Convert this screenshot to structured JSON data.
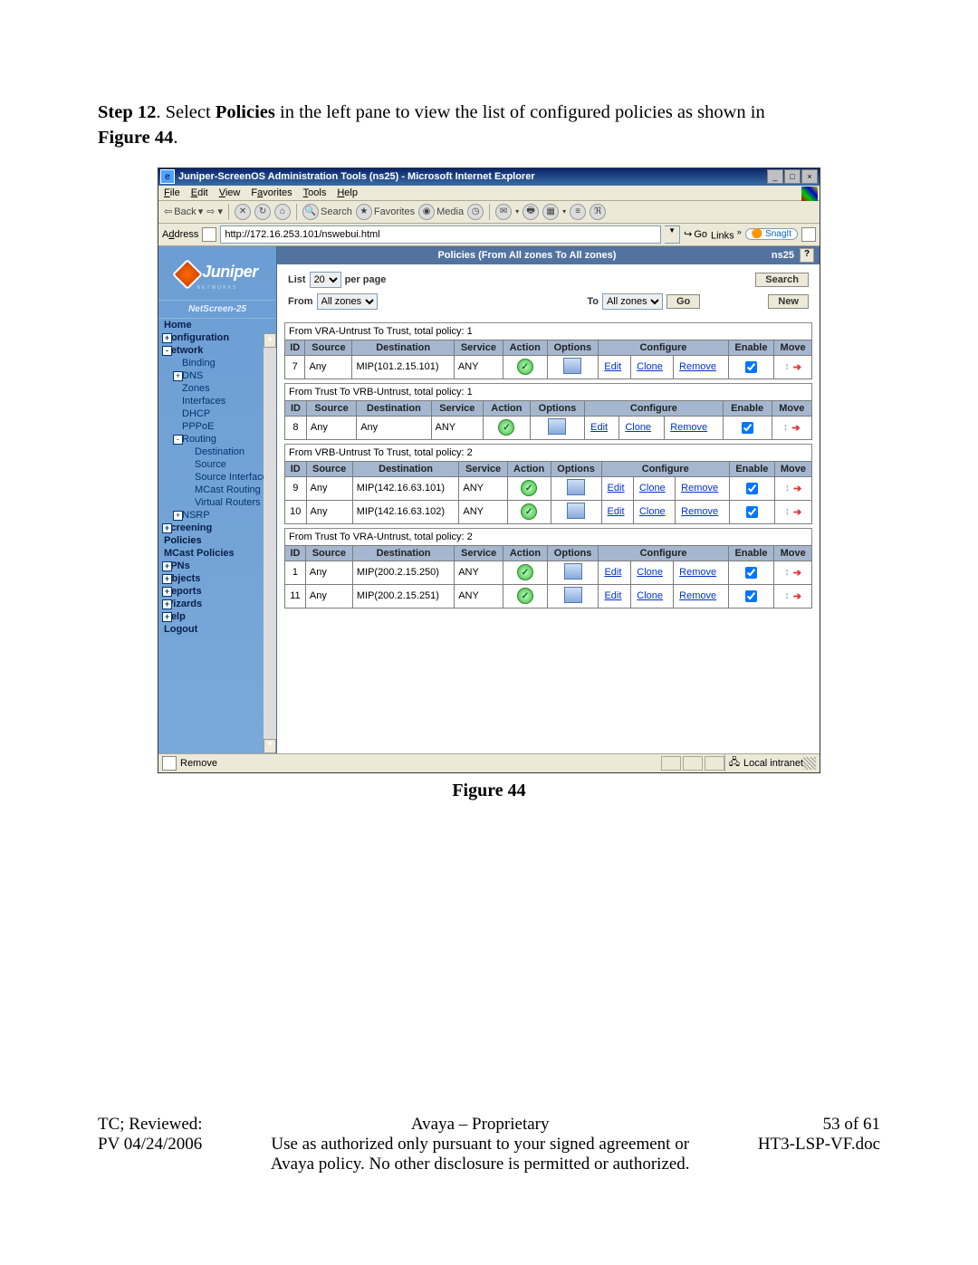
{
  "step": {
    "prefix": "Step 12",
    "mid": ". Select ",
    "bold1": "Policies",
    "mid2": " in the left pane to view the list of configured policies as shown in ",
    "fig": "Figure 44",
    "end": "."
  },
  "caption": "Figure 44",
  "ie": {
    "title": "Juniper-ScreenOS Administration Tools (ns25) - Microsoft Internet Explorer",
    "menus": [
      "File",
      "Edit",
      "View",
      "Favorites",
      "Tools",
      "Help"
    ],
    "back": "Back",
    "search": "Search",
    "fav": "Favorites",
    "media": "Media",
    "addr_label": "Address",
    "addr": "http://172.16.253.101/nswebui.html",
    "go": "Go",
    "links": "Links",
    "snag": "SnagIt",
    "status_left": "Remove",
    "status_zone": "Local intranet"
  },
  "nav": {
    "logo": "Juniper",
    "logo_sub": "NETWORKS",
    "product": "NetScreen-25",
    "items": [
      {
        "l": 0,
        "t": "Home"
      },
      {
        "l": 0,
        "t": "Configuration",
        "exp": "+"
      },
      {
        "l": 0,
        "t": "Network",
        "exp": "-"
      },
      {
        "l": 1,
        "t": "Binding"
      },
      {
        "l": 1,
        "t": "DNS",
        "exp": "+"
      },
      {
        "l": 1,
        "t": "Zones"
      },
      {
        "l": 1,
        "t": "Interfaces"
      },
      {
        "l": 1,
        "t": "DHCP"
      },
      {
        "l": 1,
        "t": "PPPoE"
      },
      {
        "l": 1,
        "t": "Routing",
        "exp": "-"
      },
      {
        "l": 2,
        "t": "Destination"
      },
      {
        "l": 2,
        "t": "Source"
      },
      {
        "l": 2,
        "t": "Source Interface"
      },
      {
        "l": 2,
        "t": "MCast Routing"
      },
      {
        "l": 2,
        "t": "Virtual Routers"
      },
      {
        "l": 1,
        "t": "NSRP",
        "exp": "+"
      },
      {
        "l": 0,
        "t": "Screening",
        "exp": "+"
      },
      {
        "l": 0,
        "t": "Policies",
        "pol": true
      },
      {
        "l": 0,
        "t": "MCast Policies"
      },
      {
        "l": 0,
        "t": "VPNs",
        "exp": "+"
      },
      {
        "l": 0,
        "t": "Objects",
        "exp": "+"
      },
      {
        "l": 0,
        "t": "Reports",
        "exp": "+"
      },
      {
        "l": 0,
        "t": "Wizards",
        "exp": "+"
      },
      {
        "l": 0,
        "t": "Help",
        "exp": "+"
      },
      {
        "l": 0,
        "t": "Logout"
      }
    ]
  },
  "page": {
    "title": "Policies (From All zones To All zones)",
    "ns": "ns25",
    "list_label": "List",
    "per_page_val": "20",
    "per_page": "per page",
    "search": "Search",
    "from": "From",
    "from_v": "All zones",
    "to": "To",
    "to_v": "All zones",
    "go": "Go",
    "new": "New"
  },
  "headers": [
    "ID",
    "Source",
    "Destination",
    "Service",
    "Action",
    "Options",
    "Configure",
    "Enable",
    "Move"
  ],
  "cfg_links": [
    "Edit",
    "Clone",
    "Remove"
  ],
  "groups": [
    {
      "cap": "From VRA-Untrust To Trust, total policy: 1",
      "rows": [
        {
          "id": 7,
          "src": "Any",
          "dst": "MIP(101.2.15.101)",
          "svc": "ANY"
        }
      ]
    },
    {
      "cap": "From Trust To VRB-Untrust, total policy: 1",
      "rows": [
        {
          "id": 8,
          "src": "Any",
          "dst": "Any",
          "svc": "ANY"
        }
      ]
    },
    {
      "cap": "From VRB-Untrust To Trust, total policy: 2",
      "rows": [
        {
          "id": 9,
          "src": "Any",
          "dst": "MIP(142.16.63.101)",
          "svc": "ANY"
        },
        {
          "id": 10,
          "src": "Any",
          "dst": "MIP(142.16.63.102)",
          "svc": "ANY"
        }
      ]
    },
    {
      "cap": "From Trust To VRA-Untrust, total policy: 2",
      "rows": [
        {
          "id": 1,
          "src": "Any",
          "dst": "MIP(200.2.15.250)",
          "svc": "ANY"
        },
        {
          "id": 11,
          "src": "Any",
          "dst": "MIP(200.2.15.251)",
          "svc": "ANY"
        }
      ]
    }
  ],
  "footer": {
    "l1": "TC; Reviewed:",
    "l2": "PV 04/24/2006",
    "c1": "Avaya – Proprietary",
    "c2": "Use as authorized only pursuant to your signed agreement or",
    "c3": "Avaya policy. No other disclosure is permitted or authorized.",
    "r1": "53 of 61",
    "r2": "HT3-LSP-VF.doc"
  }
}
